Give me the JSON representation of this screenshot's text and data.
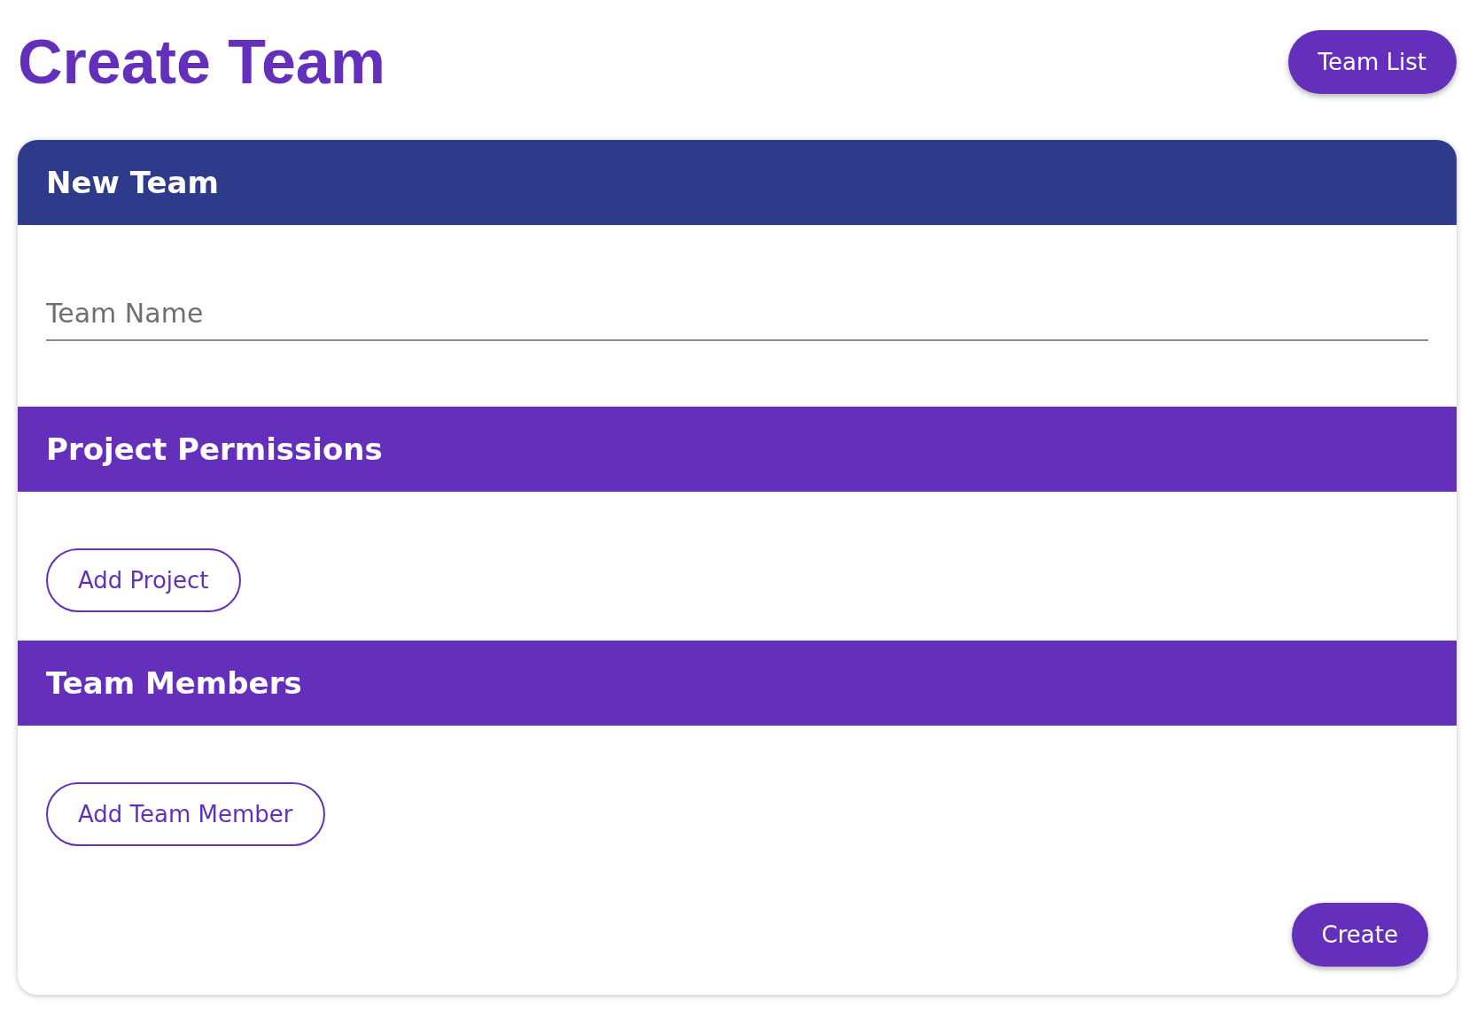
{
  "page_title": "Create Team",
  "header_button": "Team List",
  "sections": [
    {
      "title": "New Team",
      "color": "#2e3a8a",
      "kind": "field",
      "placeholder": "Team Name"
    },
    {
      "title": "Project Permissions",
      "color": "#6430bb",
      "kind": "button",
      "button": "Add Project"
    },
    {
      "title": "Team Members",
      "color": "#6430bb",
      "kind": "button",
      "button": "Add Team Member"
    }
  ],
  "submit_button": "Create"
}
